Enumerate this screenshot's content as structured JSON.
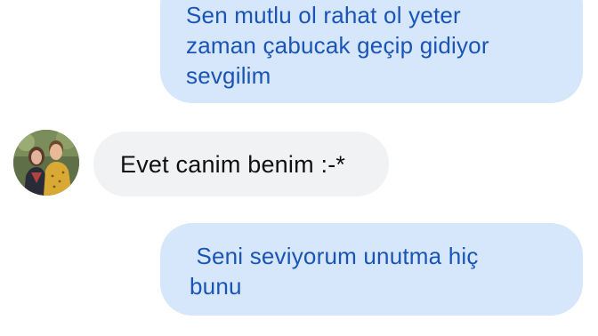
{
  "messages": [
    {
      "direction": "outgoing",
      "text": "Sen mutlu ol rahat ol yeter\nzaman çabucak geçip gidiyor\nsevgilim"
    },
    {
      "direction": "incoming",
      "text": "Evet canim benim :-*"
    },
    {
      "direction": "outgoing",
      "text": " Seni seviyorum unutma hiç\nbunu"
    }
  ],
  "contact": {
    "avatar_icon": "contact-avatar-photo"
  },
  "colors": {
    "outgoing_bubble": "#d6e6fb",
    "outgoing_text": "#1a55b6",
    "incoming_bubble": "#f1f2f4",
    "incoming_text": "#111111"
  }
}
